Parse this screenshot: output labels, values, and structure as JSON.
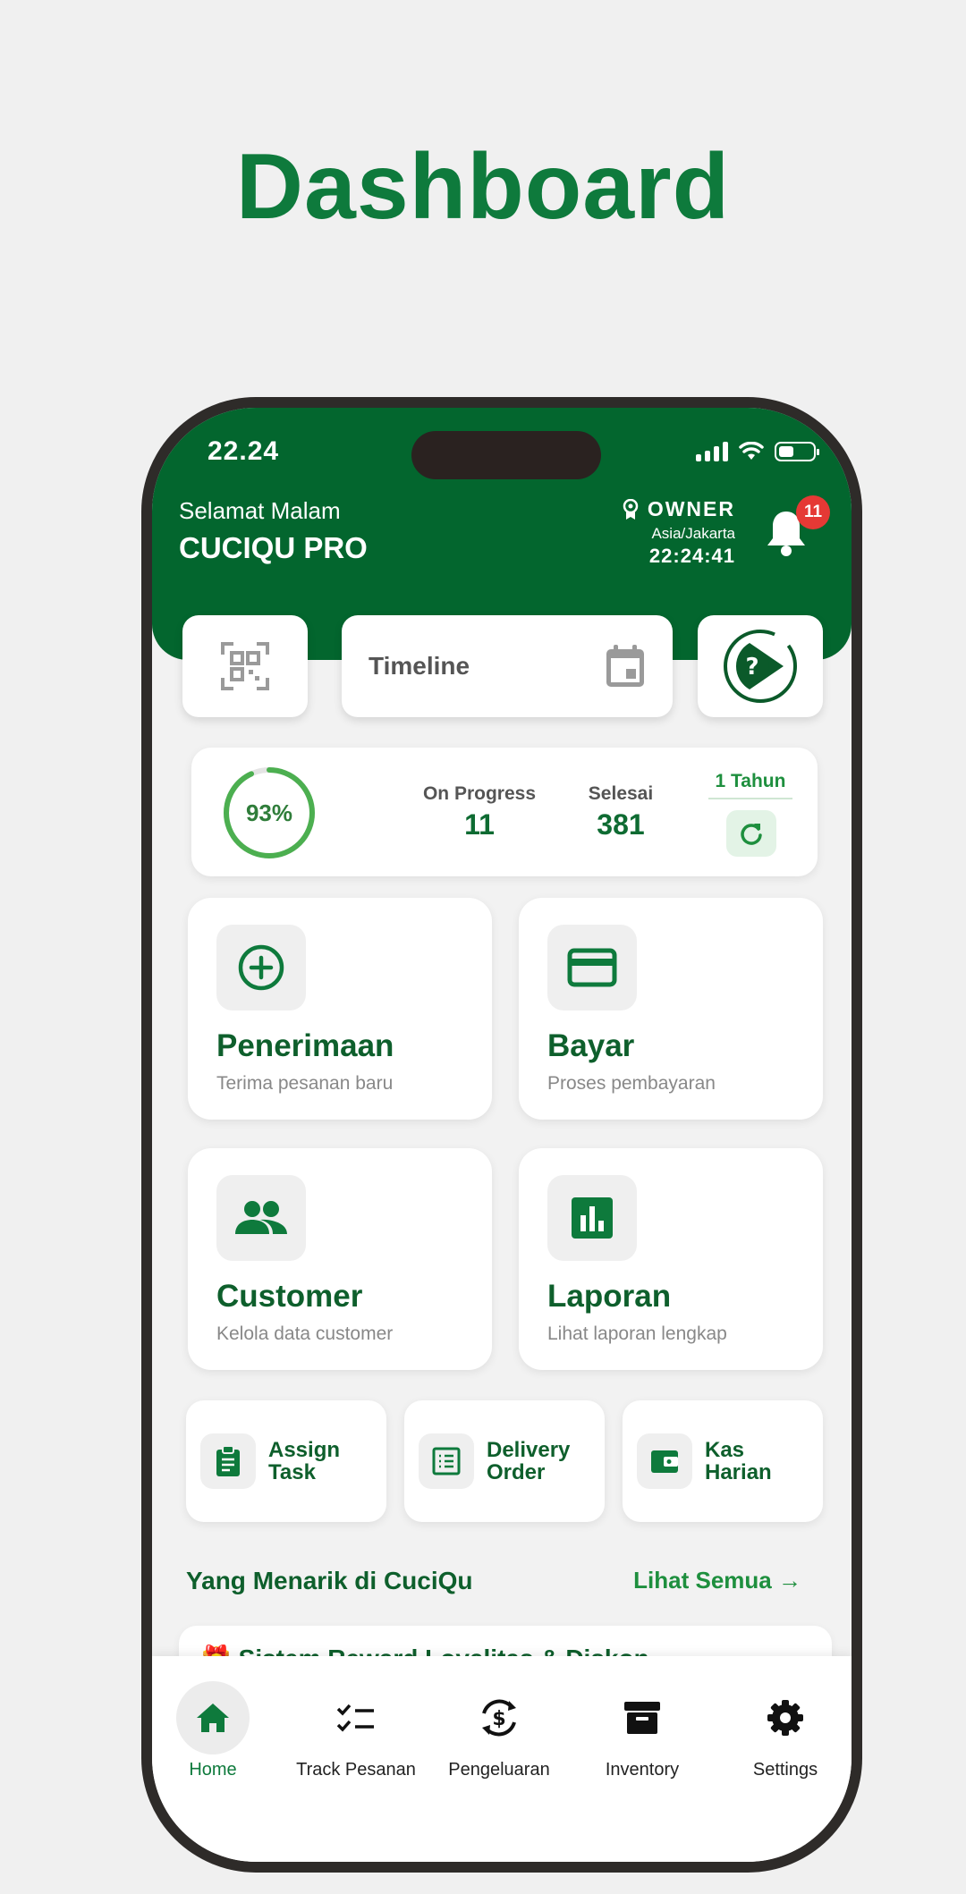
{
  "page": {
    "title": "Dashboard"
  },
  "status_bar": {
    "time": "22.24"
  },
  "header": {
    "greeting": "Selamat Malam",
    "shop_name": "CUCIQU PRO",
    "role": "OWNER",
    "timezone": "Asia/Jakarta",
    "clock": "22:24:41",
    "notification_count": "11"
  },
  "quick_actions": {
    "timeline_label": "Timeline"
  },
  "stats": {
    "progress_percent": 93,
    "progress_label": "93%",
    "on_progress_label": "On Progress",
    "on_progress_value": "11",
    "done_label": "Selesai",
    "done_value": "381",
    "period_label": "1 Tahun"
  },
  "cards": [
    {
      "title": "Penerimaan",
      "subtitle": "Terima pesanan baru",
      "icon": "plus-circle-icon"
    },
    {
      "title": "Bayar",
      "subtitle": "Proses pembayaran",
      "icon": "credit-card-icon"
    },
    {
      "title": "Customer",
      "subtitle": "Kelola data customer",
      "icon": "people-icon"
    },
    {
      "title": "Laporan",
      "subtitle": "Lihat laporan lengkap",
      "icon": "bar-chart-icon"
    }
  ],
  "mini_cards": [
    {
      "line1": "Assign",
      "line2": "Task",
      "icon": "clipboard-icon"
    },
    {
      "line1": "Delivery",
      "line2": "Order",
      "icon": "list-icon"
    },
    {
      "line1": "Kas",
      "line2": "Harian",
      "icon": "wallet-icon"
    }
  ],
  "section": {
    "title": "Yang Menarik di CuciQu",
    "link": "Lihat Semua →"
  },
  "promo": {
    "text": "🎁 Sistem Reward Loyalitas & Diskon"
  },
  "nav": [
    {
      "label": "Home",
      "icon": "home-icon",
      "active": true
    },
    {
      "label": "Track Pesanan",
      "icon": "checklist-icon"
    },
    {
      "label": "Pengeluaran",
      "icon": "money-cycle-icon"
    },
    {
      "label": "Inventory",
      "icon": "archive-icon"
    },
    {
      "label": "Settings",
      "icon": "gear-icon"
    }
  ],
  "colors": {
    "primary": "#03662e",
    "accent": "#1e8f3e",
    "badge": "#e53935"
  }
}
